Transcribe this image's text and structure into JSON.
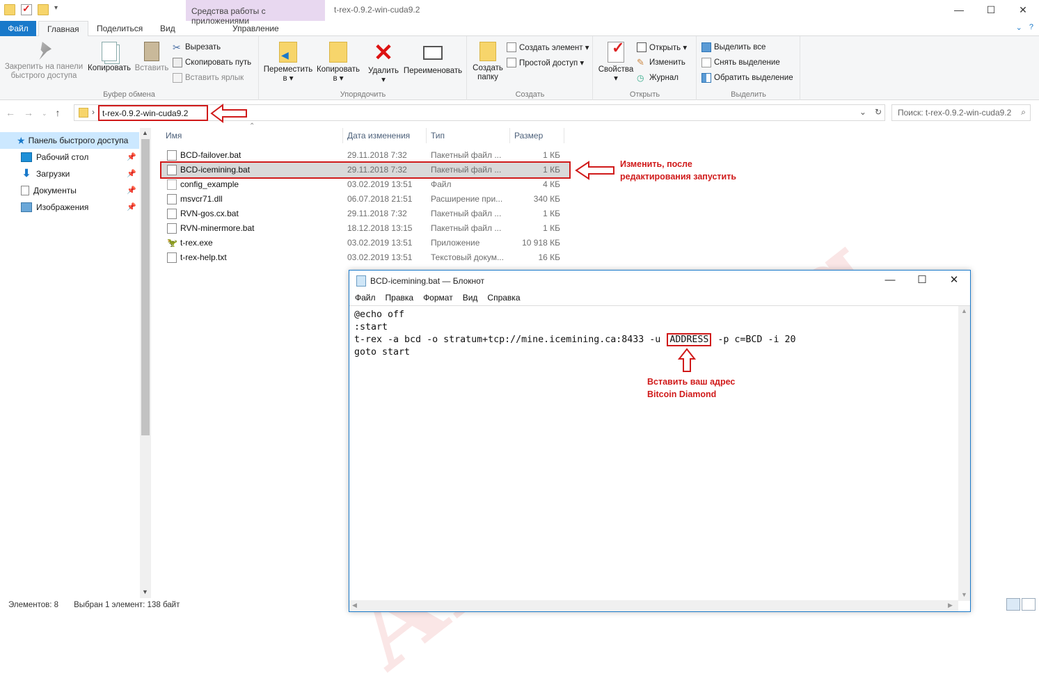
{
  "titlebar": {
    "context_tab": "Средства работы с приложениями",
    "window_title": "t-rex-0.9.2-win-cuda9.2"
  },
  "ribbon_tabs": {
    "file": "Файл",
    "home": "Главная",
    "share": "Поделиться",
    "view": "Вид",
    "manage": "Управление"
  },
  "ribbon": {
    "clipboard": {
      "pin_label_1": "Закрепить на панели",
      "pin_label_2": "быстрого доступа",
      "copy": "Копировать",
      "paste": "Вставить",
      "cut": "Вырезать",
      "copy_path": "Скопировать путь",
      "paste_shortcut": "Вставить ярлык",
      "group": "Буфер обмена"
    },
    "organize": {
      "move_1": "Переместить",
      "move_2": "в ▾",
      "copyto_1": "Копировать",
      "copyto_2": "в ▾",
      "delete": "Удалить",
      "delete_arrow": "▾",
      "rename": "Переименовать",
      "group": "Упорядочить"
    },
    "create": {
      "new_folder_1": "Создать",
      "new_folder_2": "папку",
      "new_item": "Создать элемент ▾",
      "easy_access": "Простой доступ ▾",
      "group": "Создать"
    },
    "open": {
      "properties": "Свойства",
      "properties_arrow": "▾",
      "open": "Открыть ▾",
      "edit": "Изменить",
      "history": "Журнал",
      "group": "Открыть"
    },
    "select": {
      "select_all": "Выделить все",
      "select_none": "Снять выделение",
      "invert": "Обратить выделение",
      "group": "Выделить"
    }
  },
  "address": {
    "path": "t-rex-0.9.2-win-cuda9.2",
    "search_placeholder": "Поиск: t-rex-0.9.2-win-cuda9.2"
  },
  "navpane": {
    "quick_access": "Панель быстрого доступа",
    "items": [
      "Рабочий стол",
      "Загрузки",
      "Документы",
      "Изображения"
    ]
  },
  "columns": {
    "name": "Имя",
    "date": "Дата изменения",
    "type": "Тип",
    "size": "Размер"
  },
  "files": [
    {
      "name": "BCD-failover.bat",
      "date": "29.11.2018 7:32",
      "type": "Пакетный файл ...",
      "size": "1 КБ"
    },
    {
      "name": "BCD-icemining.bat",
      "date": "29.11.2018 7:32",
      "type": "Пакетный файл ...",
      "size": "1 КБ"
    },
    {
      "name": "config_example",
      "date": "03.02.2019 13:51",
      "type": "Файл",
      "size": "4 КБ"
    },
    {
      "name": "msvcr71.dll",
      "date": "06.07.2018 21:51",
      "type": "Расширение при...",
      "size": "340 КБ"
    },
    {
      "name": "RVN-gos.cx.bat",
      "date": "29.11.2018 7:32",
      "type": "Пакетный файл ...",
      "size": "1 КБ"
    },
    {
      "name": "RVN-minermore.bat",
      "date": "18.12.2018 13:15",
      "type": "Пакетный файл ...",
      "size": "1 КБ"
    },
    {
      "name": "t-rex.exe",
      "date": "03.02.2019 13:51",
      "type": "Приложение",
      "size": "10 918 КБ"
    },
    {
      "name": "t-rex-help.txt",
      "date": "03.02.2019 13:51",
      "type": "Текстовый докум...",
      "size": "16 КБ"
    }
  ],
  "annotations": {
    "edit_1": "Изменить, после",
    "edit_2": "редактирования запустить",
    "addr_1": "Вставить ваш адрес",
    "addr_2": "Bitcoin Diamond"
  },
  "status": {
    "count": "Элементов: 8",
    "selected": "Выбран 1 элемент: 138 байт"
  },
  "watermark": "Altcoinlog",
  "notepad": {
    "title": "BCD-icemining.bat — Блокнот",
    "menu": [
      "Файл",
      "Правка",
      "Формат",
      "Вид",
      "Справка"
    ],
    "line1": "@echo off",
    "line2": ":start",
    "line3_pre": "t-rex -a bcd -o stratum+tcp://mine.icemining.ca:8433 -u",
    "line3_addr": "ADDRESS",
    "line3_post": "-p c=BCD -i 20",
    "line4": "goto start"
  },
  "colors": {
    "accent": "#1979ca",
    "annotation_red": "#d01a1a",
    "context_tab_bg": "#e8d8f0",
    "selection": "#cce8ff"
  }
}
